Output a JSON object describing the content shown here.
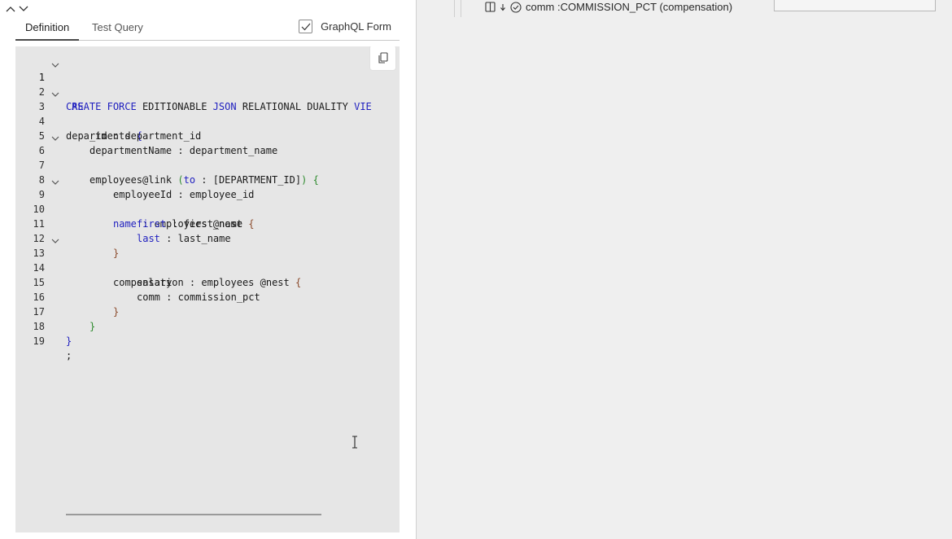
{
  "tabs": [
    {
      "label": "Definition"
    },
    {
      "label": "Test Query"
    }
  ],
  "graphql_form": {
    "label": "GraphQL Form",
    "checked": true
  },
  "editor": {
    "lines": [
      {
        "n": "1",
        "fold": true
      },
      {
        "n": "2",
        "fold": false
      },
      {
        "n": "3",
        "fold": true
      },
      {
        "n": "4",
        "fold": false
      },
      {
        "n": "5",
        "fold": false
      },
      {
        "n": "6",
        "fold": true
      },
      {
        "n": "7",
        "fold": false
      },
      {
        "n": "8",
        "fold": false
      },
      {
        "n": "9",
        "fold": true
      },
      {
        "n": "10",
        "fold": false
      },
      {
        "n": "11",
        "fold": false
      },
      {
        "n": "12",
        "fold": false
      },
      {
        "n": "13",
        "fold": true
      },
      {
        "n": "14",
        "fold": false
      },
      {
        "n": "15",
        "fold": false
      },
      {
        "n": "16",
        "fold": false
      },
      {
        "n": "17",
        "fold": false
      },
      {
        "n": "18",
        "fold": false
      },
      {
        "n": "19",
        "fold": false
      }
    ],
    "tokens": {
      "l1_create": "CREATE",
      "l1_force": "FORCE",
      "l1_editionable": "EDITIONABLE",
      "l1_json": "JSON",
      "l1_rest": "RELATIONAL DUALITY",
      "l1_view": "VIE",
      "l2_as": "AS",
      "l3_name": "departments",
      "l3_brace": "{",
      "l4_text": "_id : department_id",
      "l5_text": "departmentName : department_name",
      "l6_text": "employees",
      "l7_link": "@link",
      "l7_paren_open": "(",
      "l7_to": "to",
      "l7_mid": " : [DEPARTMENT_ID]",
      "l7_paren_close": ")",
      "l7_brace": "{",
      "l8_text": "employeeId : employee_id",
      "l9_name": "name",
      "l9_rest": " : employees @nest",
      "l9_brace": "{",
      "l10_first": "first",
      "l10_rest": " : first_name",
      "l11_last": "last",
      "l11_rest": " : last_name",
      "l12_brace": "}",
      "l13_text": "compensation : employees @nest",
      "l13_brace": "{",
      "l14_text": "salary",
      "l15_text": "comm : commission_pct",
      "l16_brace": "}",
      "l17_brace": "}",
      "l18_brace": "}",
      "l19_text": ";"
    }
  },
  "right_panel": {
    "tree_row_label": "comm :COMMISSION_PCT (compensation)",
    "icons": [
      "split-panel-icon",
      "arrow-down-icon",
      "check-circle-icon"
    ]
  },
  "icons": {
    "collapse_up": "chevron-up-icon",
    "collapse_down": "chevron-down-icon",
    "copy": "copy-icon",
    "cursor": "text-cursor-icon"
  },
  "colors": {
    "keyword": "#1f1fbf",
    "bracket_level2": "#2e8b2e",
    "bracket_level3": "#8b4a2b",
    "editor_bg": "#e6e6e6"
  }
}
